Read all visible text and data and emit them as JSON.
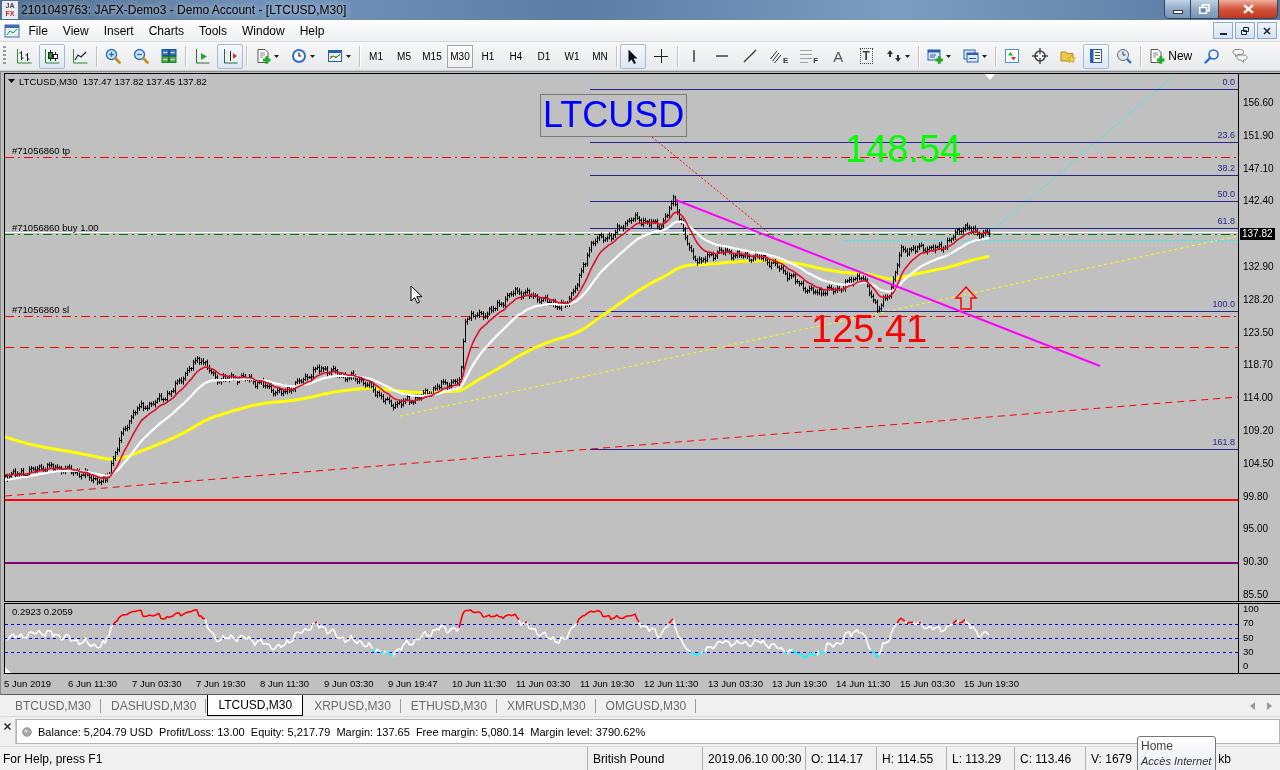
{
  "window": {
    "logo": [
      "JA",
      "FX"
    ],
    "title": "2101049763: JAFX-Demo3 - Demo Account - [LTCUSD,M30]"
  },
  "menu": [
    "File",
    "View",
    "Insert",
    "Charts",
    "Tools",
    "Window",
    "Help"
  ],
  "toolbar": [
    {
      "kind": "tools",
      "items": [
        {
          "kind": "bar-chart",
          "pressed": false,
          "dropdown": false
        },
        {
          "kind": "candles",
          "pressed": true,
          "dropdown": false
        },
        {
          "kind": "line-chart",
          "pressed": false,
          "dropdown": false
        }
      ]
    },
    {
      "kind": "tools",
      "items": [
        {
          "kind": "zoom-in",
          "pressed": false,
          "dropdown": false
        },
        {
          "kind": "zoom-out",
          "pressed": false,
          "dropdown": false
        },
        {
          "kind": "tile",
          "pressed": false,
          "dropdown": false
        }
      ]
    },
    {
      "kind": "tools",
      "items": [
        {
          "kind": "autoscroll",
          "pressed": false,
          "dropdown": false
        },
        {
          "kind": "chart-shift",
          "pressed": true,
          "dropdown": false
        }
      ]
    },
    {
      "kind": "tools",
      "items": [
        {
          "kind": "new-chart",
          "pressed": false,
          "dropdown": true
        },
        {
          "kind": "clock",
          "pressed": false,
          "dropdown": true
        },
        {
          "kind": "templates",
          "pressed": false,
          "dropdown": true
        }
      ]
    },
    {
      "kind": "periods",
      "items": [
        {
          "label": "M1",
          "selected": false
        },
        {
          "label": "M5",
          "selected": false
        },
        {
          "label": "M15",
          "selected": false
        },
        {
          "label": "M30",
          "selected": true
        },
        {
          "label": "H1",
          "selected": false
        },
        {
          "label": "H4",
          "selected": false
        },
        {
          "label": "D1",
          "selected": false
        },
        {
          "label": "W1",
          "selected": false
        },
        {
          "label": "MN",
          "selected": false
        }
      ]
    },
    {
      "kind": "tools",
      "items": [
        {
          "kind": "cursor",
          "pressed": true,
          "dropdown": false
        },
        {
          "kind": "crosshair",
          "pressed": false,
          "dropdown": false
        }
      ]
    },
    {
      "kind": "tools",
      "items": [
        {
          "kind": "vline",
          "pressed": false,
          "dropdown": false
        },
        {
          "kind": "hline",
          "pressed": false,
          "dropdown": false
        },
        {
          "kind": "trendline",
          "pressed": false,
          "dropdown": false
        },
        {
          "kind": "channel",
          "pressed": false,
          "dropdown": false,
          "glyph": "E"
        },
        {
          "kind": "fibo",
          "pressed": false,
          "dropdown": false,
          "glyph": "F"
        },
        {
          "kind": "text",
          "pressed": false,
          "dropdown": false,
          "glyph": "A"
        },
        {
          "kind": "label",
          "pressed": false,
          "dropdown": false,
          "glyph": "T"
        },
        {
          "kind": "arrows",
          "pressed": false,
          "dropdown": true
        }
      ]
    },
    {
      "kind": "tools",
      "items": [
        {
          "kind": "add-indicator",
          "pressed": false,
          "dropdown": true
        },
        {
          "kind": "profiles",
          "pressed": false,
          "dropdown": true
        }
      ]
    },
    {
      "kind": "tools",
      "items": [
        {
          "kind": "market-watch",
          "pressed": false,
          "dropdown": false
        },
        {
          "kind": "navigator",
          "pressed": false,
          "dropdown": false
        },
        {
          "kind": "favorites",
          "pressed": false,
          "dropdown": false
        },
        {
          "kind": "data-window",
          "pressed": true,
          "dropdown": false
        },
        {
          "kind": "tester",
          "pressed": false,
          "dropdown": false
        }
      ]
    },
    {
      "kind": "tools",
      "items": [
        {
          "kind": "new-order",
          "pressed": false,
          "dropdown": false,
          "label": "New"
        },
        {
          "kind": "search",
          "pressed": false,
          "dropdown": false
        },
        {
          "kind": "chat",
          "pressed": false,
          "dropdown": false
        }
      ]
    }
  ],
  "chart": {
    "header": "LTCUSD,M30  137.47 137.82 137.45 137.82",
    "price_axis": [
      {
        "label": "156.60",
        "kind": "tick"
      },
      {
        "label": "151.90",
        "kind": "tick"
      },
      {
        "label": "147.10",
        "kind": "tick"
      },
      {
        "label": "142.40",
        "kind": "tick"
      },
      {
        "label": "137.82",
        "kind": "current"
      },
      {
        "label": "132.90",
        "kind": "tick"
      },
      {
        "label": "128.20",
        "kind": "tick"
      },
      {
        "label": "123.50",
        "kind": "tick"
      },
      {
        "label": "118.70",
        "kind": "tick"
      },
      {
        "label": "114.00",
        "kind": "tick"
      },
      {
        "label": "109.20",
        "kind": "tick"
      },
      {
        "label": "104.50",
        "kind": "tick"
      },
      {
        "label": "99.80",
        "kind": "tick"
      },
      {
        "label": "95.00",
        "kind": "tick"
      },
      {
        "label": "90.30",
        "kind": "tick"
      },
      {
        "label": "85.50",
        "kind": "tick"
      }
    ],
    "fib_levels": [
      "0.0",
      "23.6",
      "38.2",
      "50.0",
      "61.8",
      "100.0",
      "161.8"
    ],
    "orders": [
      {
        "label": "#71056860 tp",
        "kind": "take-profit"
      },
      {
        "label": "#71056860 buy 1.00",
        "kind": "entry"
      },
      {
        "label": "#71056860 sl",
        "kind": "stop-loss"
      }
    ],
    "annotations": [
      {
        "text": "LTCUSD",
        "kind": "boxed",
        "color": "#0000ff"
      },
      {
        "text": "148.54",
        "kind": "plain",
        "color": "#00ff00"
      },
      {
        "text": "125.41",
        "kind": "plain",
        "color": "#ff0000"
      }
    ],
    "indicator": {
      "header": "0.2923 0.2059",
      "scale": [
        "100",
        "70",
        "50",
        "30",
        "0"
      ]
    },
    "time_axis": [
      "5 Jun 2019",
      "6 Jun 11:30",
      "7 Jun 03:30",
      "7 Jun 19:30",
      "8 Jun 11:30",
      "9 Jun 03:30",
      "9 Jun 19:47",
      "10 Jun 11:30",
      "11 Jun 03:30",
      "11 Jun 19:30",
      "12 Jun 11:30",
      "13 Jun 03:30",
      "13 Jun 19:30",
      "14 Jun 11:30",
      "15 Jun 03:30",
      "15 Jun 19:30"
    ]
  },
  "tabs": [
    {
      "label": "BTCUSD,M30",
      "selected": false
    },
    {
      "label": "DASHUSD,M30",
      "selected": false
    },
    {
      "label": "LTCUSD,M30",
      "selected": true
    },
    {
      "label": "XRPUSD,M30",
      "selected": false
    },
    {
      "label": "ETHUSD,M30",
      "selected": false
    },
    {
      "label": "XMRUSD,M30",
      "selected": false
    },
    {
      "label": "OMGUSD,M30",
      "selected": false
    }
  ],
  "terminal": {
    "line": "Balance: 5,204.79 USD  Profit/Loss: 13.00  Equity: 5,217.79  Margin: 137.65  Free margin: 5,080.14  Margin level: 3790.62%"
  },
  "status_bar": [
    "For Help, press F1",
    "British Pound",
    "2019.06.10 00:30",
    "O: 114.17",
    "H: 114.55",
    "L: 113.29",
    "C: 113.46",
    "V: 1679",
    "kb"
  ],
  "tooltip": {
    "title": "Home",
    "text": "Accès Internet"
  }
}
